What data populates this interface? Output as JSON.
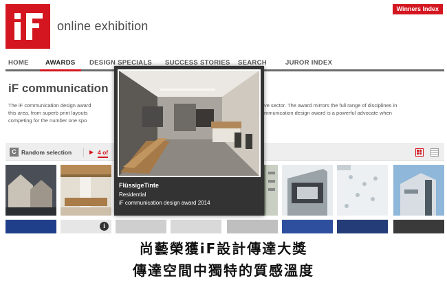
{
  "brand": {
    "logo_text": "iF",
    "site_title": "online exhibition",
    "winners_label": "Winners Index"
  },
  "nav": {
    "items": [
      {
        "label": "HOME"
      },
      {
        "label": "AWARDS"
      },
      {
        "label": "DESIGN SPECIALS"
      },
      {
        "label": "SUCCESS STORIES"
      },
      {
        "label": "SEARCH"
      },
      {
        "label": "JUROR INDEX"
      }
    ],
    "active": "AWARDS"
  },
  "section": {
    "title": "iF communication",
    "desc_left": [
      "The iF communication design award",
      "this area, from superb print layouts",
      "competing for the number one spo"
    ],
    "desc_right": [
      "ve sector. The award mirrors the full range of disciplines in",
      "mmunication design award is a powerful advocate when"
    ]
  },
  "toolbar": {
    "random_label": "Random selection",
    "page_label": "4 of"
  },
  "popup": {
    "title": "FlüssigeTinte",
    "category": "Residential",
    "award": "iF communication design award 2014"
  },
  "caption": {
    "line1": "尚藝榮獲iF設計傳達大獎",
    "line2": "傳達空間中獨特的質感溫度"
  },
  "icons": [
    "refresh-icon",
    "grid-view-icon",
    "list-view-icon",
    "info-icon"
  ],
  "colors": {
    "accent": "#d3161f",
    "popup_bg": "#333333"
  }
}
